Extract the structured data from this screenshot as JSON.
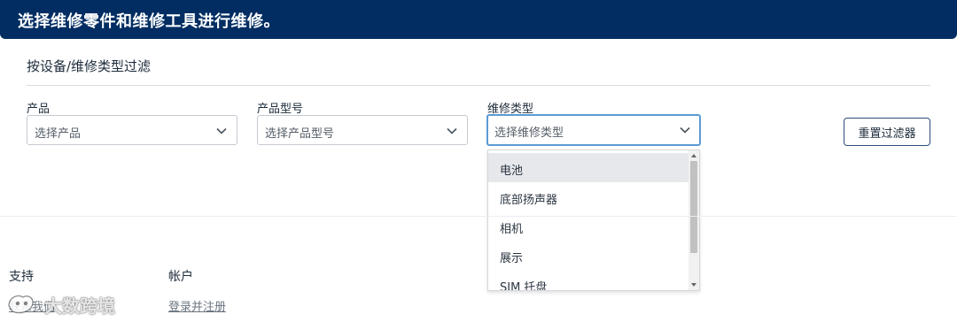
{
  "banner": {
    "title": "选择维修零件和维修工具进行维修。"
  },
  "filters": {
    "heading": "按设备/维修类型过滤",
    "product": {
      "label": "产品",
      "placeholder": "选择产品"
    },
    "model": {
      "label": "产品型号",
      "placeholder": "选择产品型号"
    },
    "repair_type": {
      "label": "维修类型",
      "placeholder": "选择维修类型"
    },
    "reset_label": "重置过滤器"
  },
  "dropdown": {
    "items": [
      "电池",
      "底部扬声器",
      "相机",
      "展示",
      "SIM 托盘"
    ],
    "highlighted_index": 0
  },
  "footer": {
    "support": {
      "heading": "支持",
      "link": "联系我们"
    },
    "account": {
      "heading": "帐户",
      "link": "登录并注册"
    }
  },
  "watermark": {
    "text": "大数跨境"
  },
  "colors": {
    "banner": "#012d62",
    "focus_border": "#5b9bd5",
    "highlight": "#e6e8eb"
  },
  "icons": {
    "select_chevron": "chevron-down-icon",
    "scroll_up": "scroll-up-arrow-icon",
    "scroll_down": "scroll-down-arrow-icon"
  }
}
